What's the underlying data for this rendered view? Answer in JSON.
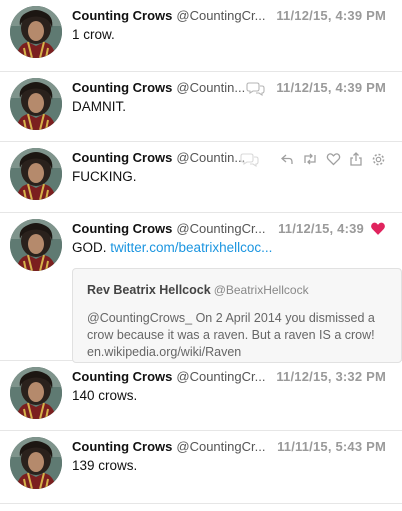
{
  "tweets": [
    {
      "name": "Counting Crows",
      "handle": "@CountingCr...",
      "time": "11/12/15, 4:39 PM",
      "text": "1 crow."
    },
    {
      "name": "Counting Crows",
      "handle": "@Countin...",
      "time": "11/12/15, 4:39 PM",
      "text": "DAMNIT."
    },
    {
      "name": "Counting Crows",
      "handle": "@Countin...",
      "time": "",
      "text": "FUCKING."
    },
    {
      "name": "Counting Crows",
      "handle": "@CountingCr...",
      "time": "11/12/15, 4:39",
      "text": "GOD.",
      "link": "twitter.com/beatrixhellcoc...",
      "quote": {
        "name": "Rev Beatrix Hellcock",
        "handle": "@BeatrixHellcock",
        "line1": "@CountingCrows_ On 2 April 2014 you dismissed a",
        "line2": "crow because it was a raven. But a raven IS a crow!",
        "line3": "en.wikipedia.org/wiki/Raven"
      }
    },
    {
      "name": "Counting Crows",
      "handle": "@CountingCr...",
      "time": "11/12/15, 3:32 PM",
      "text": "140 crows."
    },
    {
      "name": "Counting Crows",
      "handle": "@CountingCr...",
      "time": "11/11/15, 5:43 PM",
      "text": "139 crows."
    }
  ],
  "colors": {
    "link": "#1b95e0",
    "liked_heart": "#e0245e",
    "timestamp": "#9a9a9a",
    "action_icon": "#b5b5b5"
  },
  "icons": {
    "reply": "reply-icon",
    "retweet": "retweet-icon",
    "like": "heart-icon",
    "share": "share-icon",
    "settings": "gear-icon",
    "comment": "speech-bubble-icon"
  }
}
